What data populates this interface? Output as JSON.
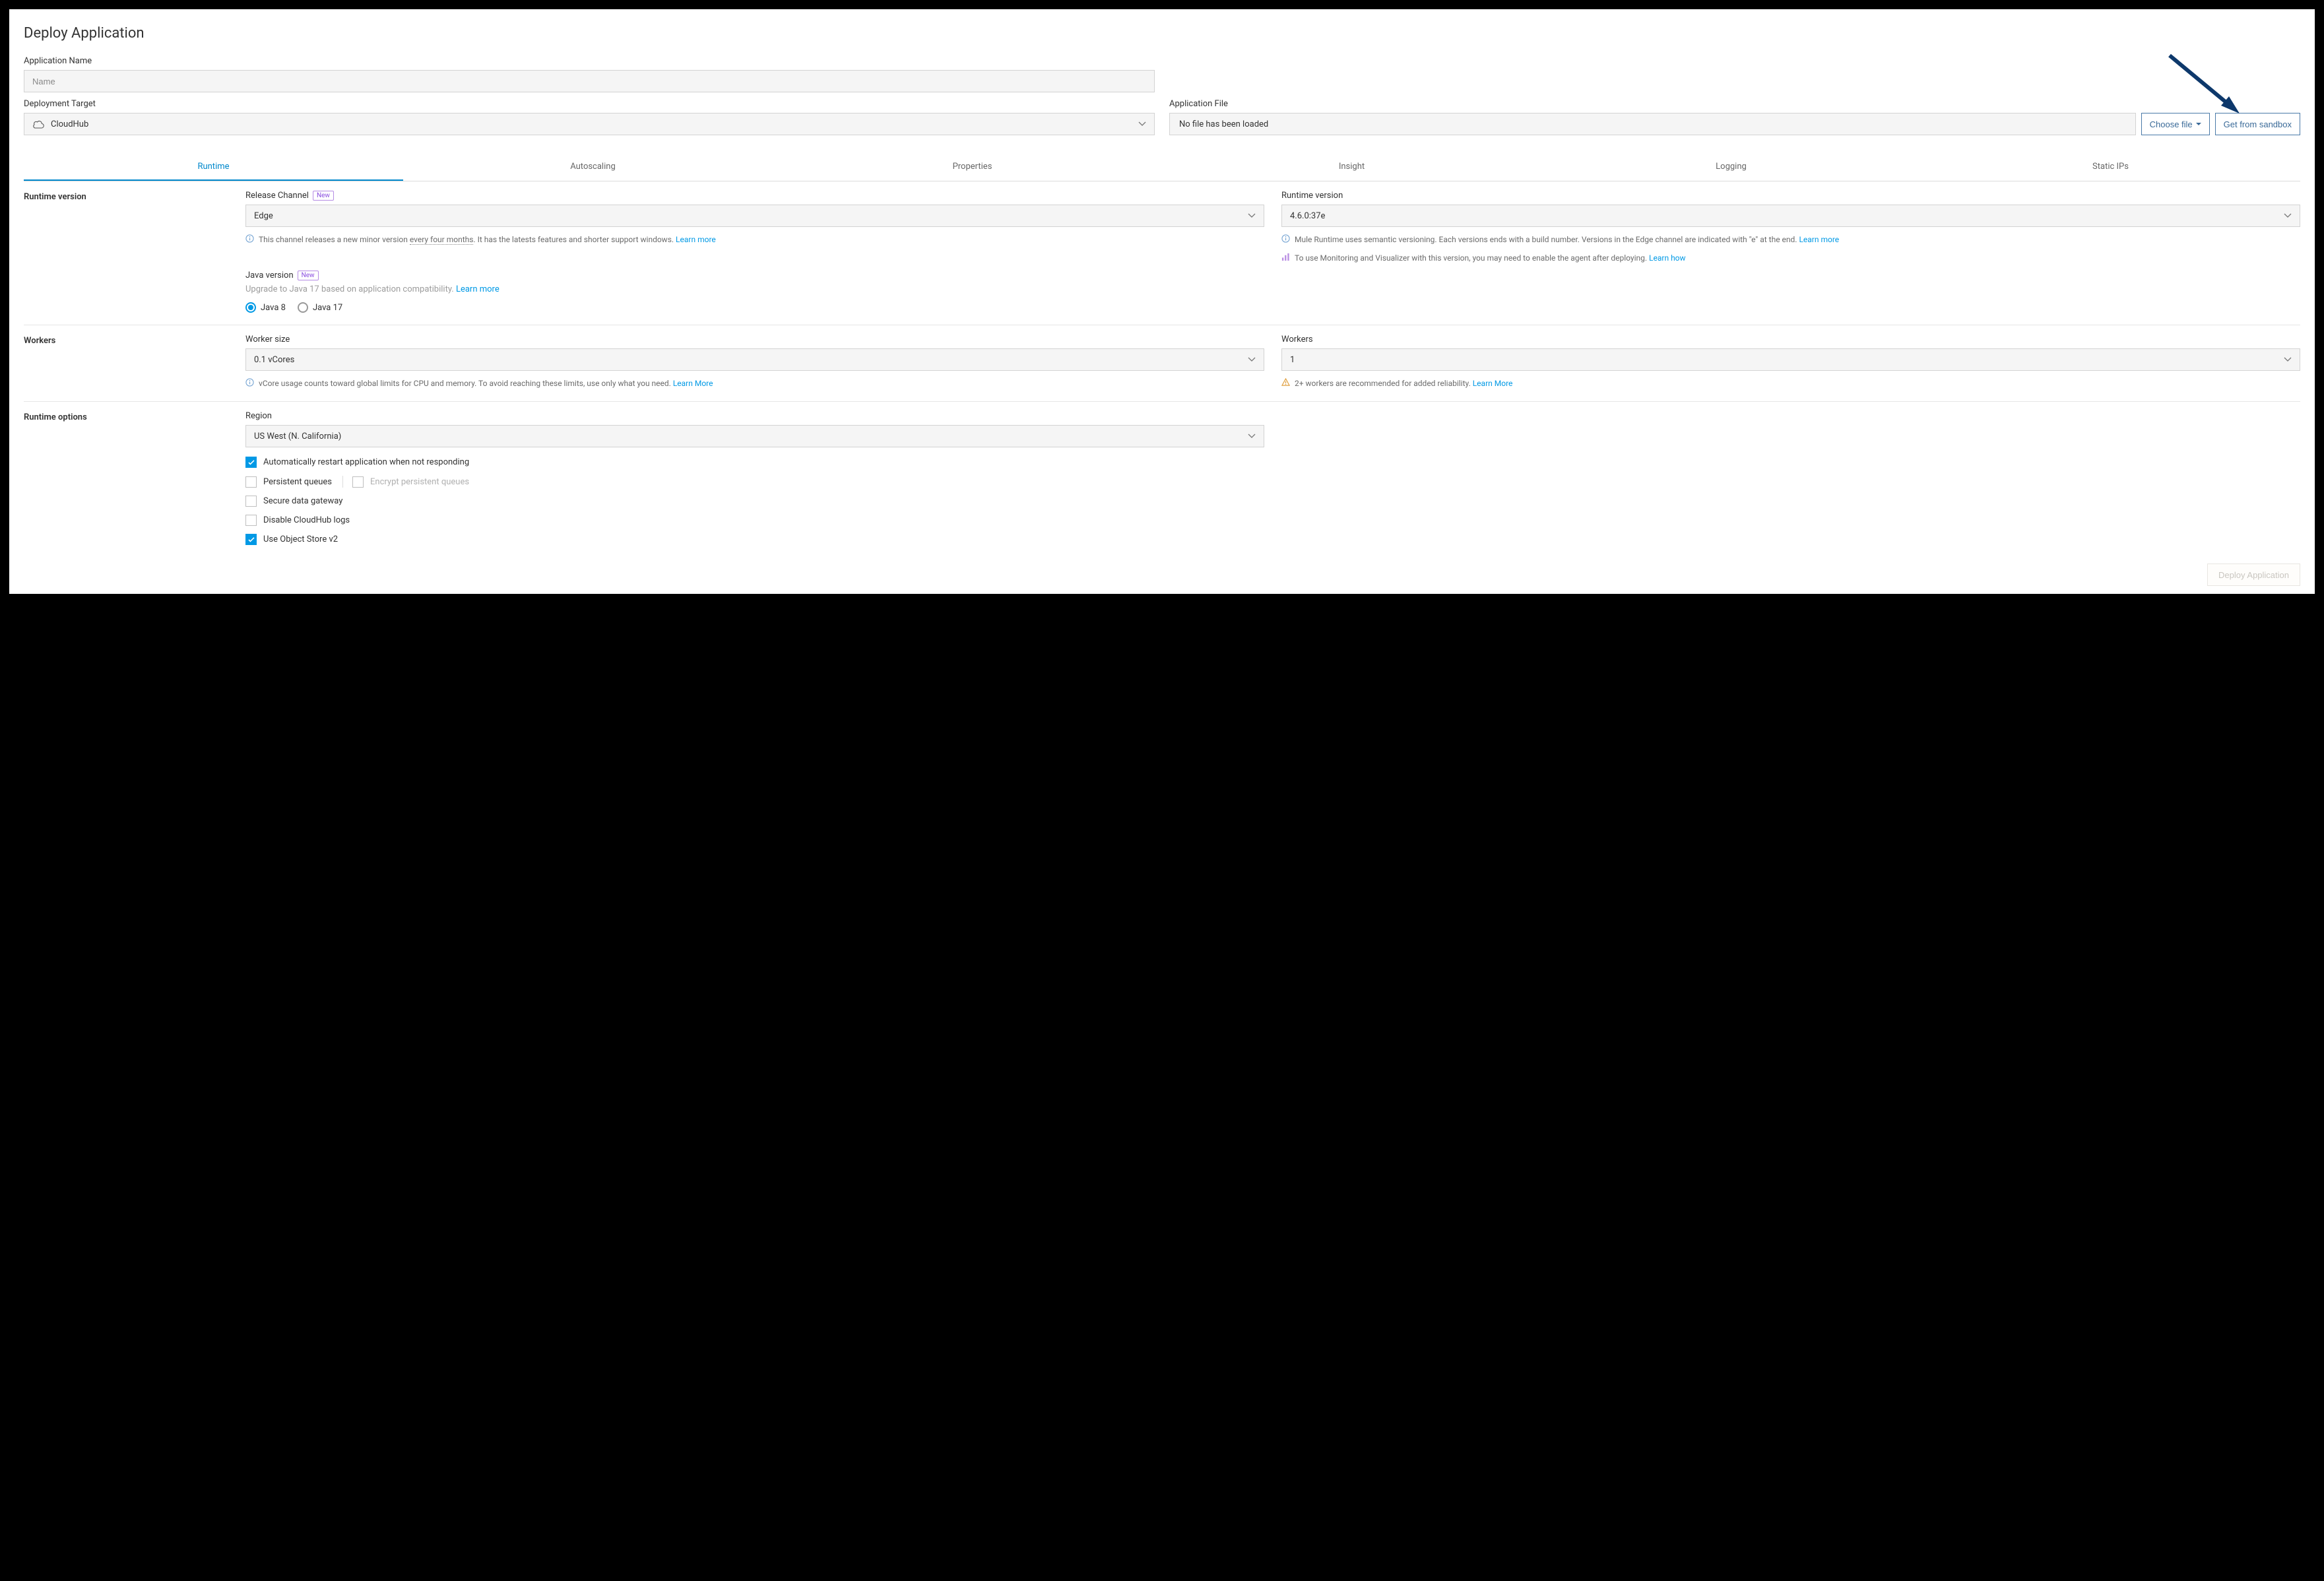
{
  "page": {
    "title": "Deploy Application"
  },
  "appName": {
    "label": "Application Name",
    "placeholder": "Name"
  },
  "deployTarget": {
    "label": "Deployment Target",
    "value": "CloudHub"
  },
  "appFile": {
    "label": "Application File",
    "value": "No file has been loaded",
    "chooseBtn": "Choose file",
    "sandboxBtn": "Get from sandbox"
  },
  "tabs": [
    "Runtime",
    "Autoscaling",
    "Properties",
    "Insight",
    "Logging",
    "Static IPs"
  ],
  "runtimeVersion": {
    "section": "Runtime version",
    "releaseChannel": {
      "label": "Release Channel",
      "badge": "New",
      "value": "Edge",
      "helpA": "This channel releases a new minor version ",
      "helpMid": "every four months",
      "helpB": ". It has the latests features and shorter support windows. ",
      "helpLink": "Learn more"
    },
    "version": {
      "label": "Runtime version",
      "value": "4.6.0:37e",
      "help1": "Mule Runtime uses semantic versioning. Each versions ends with a build number. Versions in the Edge channel are indicated with \"e\" at the end. ",
      "help1Link": "Learn more",
      "help2": "To use Monitoring and Visualizer with this version, you may need to enable the agent after deploying. ",
      "help2Link": "Learn how"
    },
    "java": {
      "label": "Java version",
      "badge": "New",
      "sub": "Upgrade to Java 17 based on application compatibility. ",
      "subLink": "Learn more",
      "opt1": "Java 8",
      "opt2": "Java 17"
    }
  },
  "workers": {
    "section": "Workers",
    "size": {
      "label": "Worker size",
      "value": "0.1 vCores",
      "help": "vCore usage counts toward global limits for CPU and memory. To avoid reaching these limits, use only what you need. ",
      "helpLink": "Learn More"
    },
    "count": {
      "label": "Workers",
      "value": "1",
      "help": "2+ workers are recommended for added reliability. ",
      "helpLink": "Learn More"
    }
  },
  "runtimeOptions": {
    "section": "Runtime options",
    "region": {
      "label": "Region",
      "value": "US West (N. California)"
    },
    "checks": {
      "autoRestart": "Automatically restart application when not responding",
      "persistentQueues": "Persistent queues",
      "encryptQueues": "Encrypt persistent queues",
      "secureGateway": "Secure data gateway",
      "disableLogs": "Disable CloudHub logs",
      "objectStore": "Use Object Store v2"
    }
  },
  "footer": {
    "deploy": "Deploy Application"
  }
}
